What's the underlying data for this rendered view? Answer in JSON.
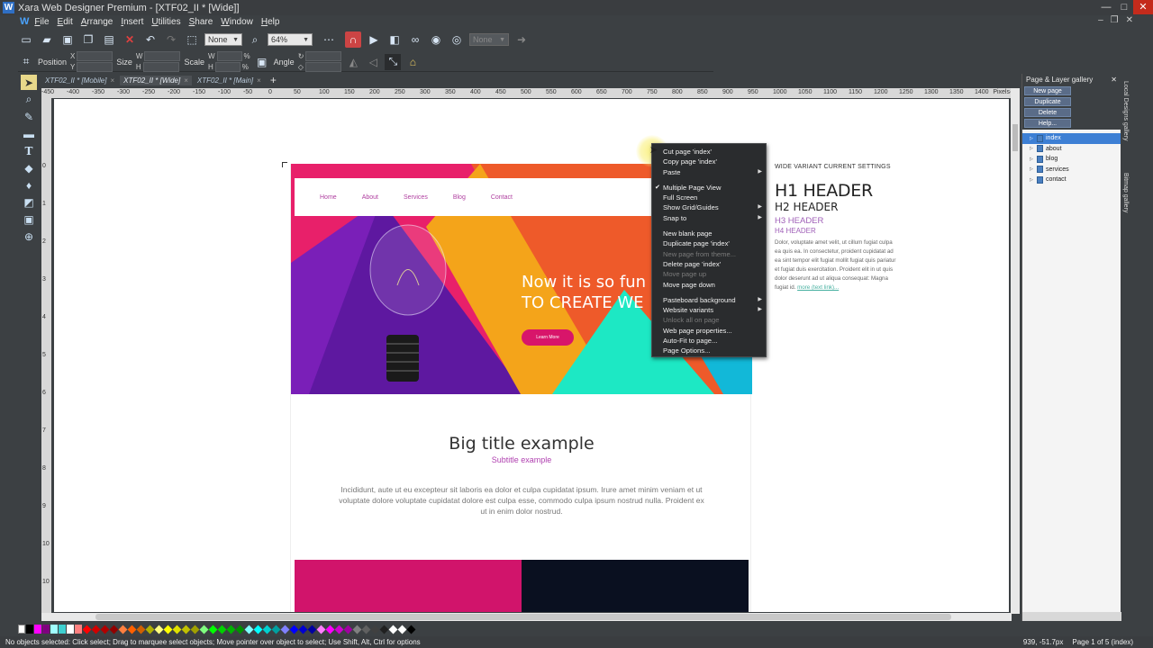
{
  "window": {
    "title": "Xara Web Designer Premium - [XTF02_II * [Wide]]",
    "app_icon": "W",
    "buttons": [
      "—",
      "□",
      "✕"
    ],
    "mdi_buttons": [
      "–",
      "❐",
      "✕"
    ]
  },
  "menu": [
    "File",
    "Edit",
    "Arrange",
    "Insert",
    "Utilities",
    "Share",
    "Window",
    "Help"
  ],
  "menu_logo": "W",
  "toolbar": {
    "quality_select": "None",
    "zoom_value": "64%",
    "font_select": "None"
  },
  "infobar": {
    "position_label": "Position",
    "x_label": "X",
    "y_label": "Y",
    "size_label": "Size",
    "w_label": "W",
    "h_label": "H",
    "scale_label": "Scale",
    "percent": "%",
    "angle_label": "Angle"
  },
  "tabs": [
    {
      "label": "XTF02_II * [Mobile]",
      "active": false
    },
    {
      "label": "XTF02_II * [Wide]",
      "active": true
    },
    {
      "label": "XTF02_II * [Main]",
      "active": false
    }
  ],
  "tab_close": "×",
  "tab_add": "+",
  "ruler": {
    "top_ticks": [
      "-450",
      "-400",
      "-350",
      "-300",
      "-250",
      "-200",
      "-150",
      "-100",
      "-50",
      "0",
      "50",
      "100",
      "150",
      "200",
      "250",
      "300",
      "350",
      "400",
      "450",
      "500",
      "550",
      "600",
      "650",
      "700",
      "750",
      "800",
      "850",
      "900",
      "950",
      "1000",
      "1050",
      "1100",
      "1150",
      "1200",
      "1250",
      "1300",
      "1350",
      "1400",
      "1450"
    ],
    "unit": "Pixels",
    "left_ticks": [
      "0",
      "1",
      "2",
      "3",
      "4",
      "5",
      "6",
      "7",
      "8",
      "9",
      "10",
      "10",
      "11"
    ]
  },
  "page": {
    "nav": [
      "Home",
      "About",
      "Services",
      "Blog",
      "Contact"
    ],
    "hero_line1": "Now it is so fun",
    "hero_line2": "TO CREATE WE",
    "learn_more": "Learn More",
    "big_title": "Big title example",
    "subtitle": "Subtitle example",
    "paragraph": "Incididunt, aute ut eu excepteur sit laboris ea dolor et culpa cupidatat ipsum. Irure amet minim veniam et ut voluptate dolore voluptate cupidatat dolore est culpa esse, commodo culpa ipsum nostrud nulla. Proident ex ut in enim dolor nostrud."
  },
  "side_settings": {
    "label": "WIDE VARIANT CURRENT SETTINGS",
    "h1": "H1 HEADER",
    "h2": "H2 HEADER",
    "h3": "H3 HEADER",
    "h4": "H4 HEADER",
    "body": "Dolor, voluptate amet velit, ut cillum fugiat culpa ea quis ea. In consectetur, proident cupidatat ad ea sint tempor elit fugiat mollit fugiat quis pariatur et fugiat duis exercitation. Proident elit in ut quis dolor deserunt ad ut aliqua consequat: Magna fugiat id.",
    "link": "more (text link)..."
  },
  "context_menu": [
    {
      "label": "Cut page 'index'",
      "state": "normal"
    },
    {
      "label": "Copy page 'index'",
      "state": "normal"
    },
    {
      "label": "Paste",
      "state": "normal",
      "submenu": true
    },
    {
      "sep": true
    },
    {
      "label": "Multiple Page View",
      "state": "checked"
    },
    {
      "label": "Full Screen",
      "state": "normal"
    },
    {
      "label": "Show Grid/Guides",
      "state": "normal",
      "submenu": true
    },
    {
      "label": "Snap to",
      "state": "normal",
      "submenu": true
    },
    {
      "sep": true
    },
    {
      "label": "New blank page",
      "state": "normal"
    },
    {
      "label": "Duplicate page 'index'",
      "state": "normal"
    },
    {
      "label": "New page from theme...",
      "state": "disabled"
    },
    {
      "label": "Delete page 'index'",
      "state": "normal"
    },
    {
      "label": "Move page up",
      "state": "disabled"
    },
    {
      "label": "Move page down",
      "state": "normal"
    },
    {
      "sep": true
    },
    {
      "label": "Pasteboard background",
      "state": "normal",
      "submenu": true
    },
    {
      "label": "Website variants",
      "state": "normal",
      "submenu": true
    },
    {
      "label": "Unlock all on page",
      "state": "disabled"
    },
    {
      "label": "Web page properties...",
      "state": "normal"
    },
    {
      "label": "Auto-Fit to page...",
      "state": "normal"
    },
    {
      "label": "Page Options...",
      "state": "normal"
    }
  ],
  "gallery": {
    "title": "Page & Layer gallery",
    "close": "✕",
    "buttons": [
      "New page",
      "Duplicate",
      "Delete",
      "Help..."
    ],
    "pages": [
      {
        "name": "index",
        "selected": true
      },
      {
        "name": "about",
        "selected": false
      },
      {
        "name": "blog",
        "selected": false
      },
      {
        "name": "services",
        "selected": false
      },
      {
        "name": "contact",
        "selected": false
      }
    ]
  },
  "side_tabs": [
    "Local Designs gallery",
    "Bitmap gallery"
  ],
  "status": {
    "left": "No objects selected: Click select; Drag to marquee select objects; Move pointer over object to select; Use Shift, Alt, Ctrl for options",
    "coords": "939, -51.7px",
    "page_info": "Page 1 of 5 (index)"
  },
  "colors": {
    "accent": "#d8156a",
    "menu_bg": "#2a2c2e",
    "selection": "#3d7fd4"
  }
}
